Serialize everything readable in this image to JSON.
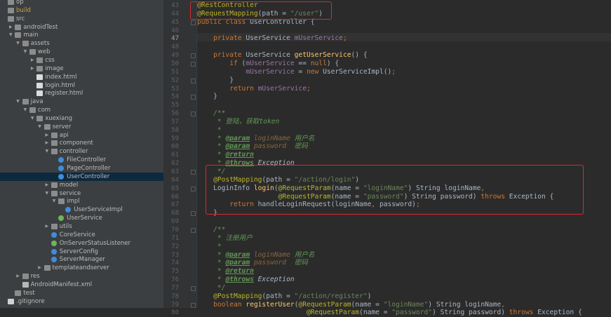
{
  "project_tree": [
    {
      "label": "op",
      "icon": "folder",
      "depth": 0,
      "arrow": ""
    },
    {
      "label": "build",
      "icon": "folder",
      "depth": 0,
      "arrow": "",
      "muted": true
    },
    {
      "label": "src",
      "icon": "folder",
      "depth": 0,
      "arrow": ""
    },
    {
      "label": "androidTest",
      "icon": "folder",
      "depth": 1,
      "arrow": "right"
    },
    {
      "label": "main",
      "icon": "folder",
      "depth": 1,
      "arrow": "down"
    },
    {
      "label": "assets",
      "icon": "folder",
      "depth": 2,
      "arrow": "down"
    },
    {
      "label": "web",
      "icon": "folder",
      "depth": 3,
      "arrow": "down"
    },
    {
      "label": "css",
      "icon": "folder",
      "depth": 4,
      "arrow": "right"
    },
    {
      "label": "image",
      "icon": "folder",
      "depth": 4,
      "arrow": "right"
    },
    {
      "label": "index.html",
      "icon": "html",
      "depth": 4,
      "arrow": ""
    },
    {
      "label": "login.html",
      "icon": "html",
      "depth": 4,
      "arrow": ""
    },
    {
      "label": "register.html",
      "icon": "html",
      "depth": 4,
      "arrow": ""
    },
    {
      "label": "java",
      "icon": "folder",
      "depth": 2,
      "arrow": "down"
    },
    {
      "label": "com",
      "icon": "pkg",
      "depth": 3,
      "arrow": "down"
    },
    {
      "label": "xuexiang",
      "icon": "pkg",
      "depth": 4,
      "arrow": "down"
    },
    {
      "label": "server",
      "icon": "pkg",
      "depth": 5,
      "arrow": "down"
    },
    {
      "label": "api",
      "icon": "pkg",
      "depth": 6,
      "arrow": "right"
    },
    {
      "label": "component",
      "icon": "pkg",
      "depth": 6,
      "arrow": "right"
    },
    {
      "label": "controller",
      "icon": "pkg",
      "depth": 6,
      "arrow": "down"
    },
    {
      "label": "FileController",
      "icon": "cls",
      "depth": 7,
      "arrow": ""
    },
    {
      "label": "PageController",
      "icon": "cls",
      "depth": 7,
      "arrow": ""
    },
    {
      "label": "UserController",
      "icon": "cls",
      "depth": 7,
      "arrow": "",
      "selected": true
    },
    {
      "label": "model",
      "icon": "pkg",
      "depth": 6,
      "arrow": "right"
    },
    {
      "label": "service",
      "icon": "pkg",
      "depth": 6,
      "arrow": "down"
    },
    {
      "label": "impl",
      "icon": "pkg",
      "depth": 7,
      "arrow": "down"
    },
    {
      "label": "UserServiceImpl",
      "icon": "cls",
      "depth": 8,
      "arrow": ""
    },
    {
      "label": "UserService",
      "icon": "iface",
      "depth": 7,
      "arrow": ""
    },
    {
      "label": "utils",
      "icon": "pkg",
      "depth": 6,
      "arrow": "right"
    },
    {
      "label": "CoreService",
      "icon": "cls",
      "depth": 6,
      "arrow": ""
    },
    {
      "label": "OnServerStatusListener",
      "icon": "iface",
      "depth": 6,
      "arrow": ""
    },
    {
      "label": "ServerConfig",
      "icon": "cls",
      "depth": 6,
      "arrow": ""
    },
    {
      "label": "ServerManager",
      "icon": "cls",
      "depth": 6,
      "arrow": ""
    },
    {
      "label": "templateandserver",
      "icon": "pkg",
      "depth": 5,
      "arrow": "right"
    },
    {
      "label": "res",
      "icon": "folder",
      "depth": 2,
      "arrow": "right"
    },
    {
      "label": "AndroidManifest.xml",
      "icon": "xml",
      "depth": 2,
      "arrow": ""
    },
    {
      "label": "test",
      "icon": "folder",
      "depth": 1,
      "arrow": ""
    },
    {
      "label": ".gitignore",
      "icon": "file",
      "depth": 0,
      "arrow": ""
    }
  ],
  "code_lines": [
    {
      "n": "43",
      "t": [
        [
          "an",
          "@RestController"
        ]
      ]
    },
    {
      "n": "44",
      "t": [
        [
          "an",
          "@RequestMapping"
        ],
        [
          "",
          "(path = "
        ],
        [
          "st",
          "\"/user\""
        ],
        [
          "",
          ")"
        ]
      ]
    },
    {
      "n": "45",
      "t": [
        [
          "kw",
          "public class "
        ],
        [
          "",
          "UserController {"
        ]
      ]
    },
    {
      "n": "46",
      "t": []
    },
    {
      "n": "47",
      "t": [
        [
          "",
          "    "
        ],
        [
          "kw",
          "private "
        ],
        [
          "",
          "UserService "
        ],
        [
          "fd",
          "mUserService"
        ],
        [
          "kw",
          ";"
        ]
      ]
    },
    {
      "n": "48",
      "t": []
    },
    {
      "n": "49",
      "t": [
        [
          "",
          "    "
        ],
        [
          "kw",
          "private "
        ],
        [
          "",
          "UserService "
        ],
        [
          "mt",
          "getUserService"
        ],
        [
          "",
          "() {"
        ]
      ]
    },
    {
      "n": "50",
      "t": [
        [
          "",
          "        "
        ],
        [
          "kw",
          "if "
        ],
        [
          "",
          "("
        ],
        [
          "fd",
          "mUserService"
        ],
        [
          "",
          " == "
        ],
        [
          "kw",
          "null"
        ],
        [
          "",
          ") {"
        ]
      ]
    },
    {
      "n": "51",
      "t": [
        [
          "",
          "            "
        ],
        [
          "fd",
          "mUserService"
        ],
        [
          "",
          " = "
        ],
        [
          "kw",
          "new "
        ],
        [
          "",
          "UserServiceImpl()"
        ],
        [
          "kw",
          ";"
        ]
      ]
    },
    {
      "n": "52",
      "t": [
        [
          "",
          "        }"
        ]
      ]
    },
    {
      "n": "53",
      "t": [
        [
          "",
          "        "
        ],
        [
          "kw",
          "return "
        ],
        [
          "fd",
          "mUserService"
        ],
        [
          "kw",
          ";"
        ]
      ]
    },
    {
      "n": "54",
      "t": [
        [
          "",
          "    }"
        ]
      ]
    },
    {
      "n": "55",
      "t": []
    },
    {
      "n": "56",
      "t": [
        [
          "cm",
          "    /**"
        ]
      ]
    },
    {
      "n": "57",
      "t": [
        [
          "cm",
          "     * 登陆，获取token"
        ]
      ]
    },
    {
      "n": "58",
      "t": [
        [
          "cm",
          "     *"
        ]
      ]
    },
    {
      "n": "59",
      "t": [
        [
          "cm",
          "     * "
        ],
        [
          "tg",
          "@param"
        ],
        [
          "cm",
          " "
        ],
        [
          "pv",
          "loginName"
        ],
        [
          "cm",
          " 用户名"
        ]
      ]
    },
    {
      "n": "60",
      "t": [
        [
          "cm",
          "     * "
        ],
        [
          "tg",
          "@param"
        ],
        [
          "cm",
          " "
        ],
        [
          "pv",
          "password"
        ],
        [
          "cm",
          "  密码"
        ]
      ]
    },
    {
      "n": "61",
      "t": [
        [
          "cm",
          "     * "
        ],
        [
          "tg",
          "@return"
        ]
      ]
    },
    {
      "n": "62",
      "t": [
        [
          "cm",
          "     * "
        ],
        [
          "tg",
          "@throws"
        ],
        [
          "cm",
          " "
        ],
        [
          "ex",
          "Exception"
        ]
      ]
    },
    {
      "n": "63",
      "t": [
        [
          "cm",
          "     */"
        ]
      ]
    },
    {
      "n": "64",
      "t": [
        [
          "",
          "    "
        ],
        [
          "an",
          "@PostMapping"
        ],
        [
          "",
          "(path = "
        ],
        [
          "st",
          "\"/action/login\""
        ],
        [
          "",
          ")"
        ]
      ]
    },
    {
      "n": "65",
      "t": [
        [
          "",
          "    LoginInfo "
        ],
        [
          "mt",
          "login"
        ],
        [
          "",
          "("
        ],
        [
          "an",
          "@RequestParam"
        ],
        [
          "",
          "(name = "
        ],
        [
          "st",
          "\"loginName\""
        ],
        [
          "",
          ") String loginName"
        ],
        [
          "kw",
          ","
        ]
      ]
    },
    {
      "n": "66",
      "t": [
        [
          "",
          "                    "
        ],
        [
          "an",
          "@RequestParam"
        ],
        [
          "",
          "(name = "
        ],
        [
          "st",
          "\"password\""
        ],
        [
          "",
          ") String password) "
        ],
        [
          "kw",
          "throws "
        ],
        [
          "",
          "Exception {"
        ]
      ]
    },
    {
      "n": "67",
      "t": [
        [
          "",
          "        "
        ],
        [
          "kw",
          "return "
        ],
        [
          "",
          "handleLoginRequest(loginName"
        ],
        [
          "kw",
          ", "
        ],
        [
          "",
          "password)"
        ],
        [
          "kw",
          ";"
        ]
      ]
    },
    {
      "n": "68",
      "t": [
        [
          "",
          "    }"
        ]
      ]
    },
    {
      "n": "69",
      "t": []
    },
    {
      "n": "70",
      "t": [
        [
          "cm",
          "    /**"
        ]
      ]
    },
    {
      "n": "71",
      "t": [
        [
          "cm",
          "     * 注册用户"
        ]
      ]
    },
    {
      "n": "72",
      "t": [
        [
          "cm",
          "     *"
        ]
      ]
    },
    {
      "n": "73",
      "t": [
        [
          "cm",
          "     * "
        ],
        [
          "tg",
          "@param"
        ],
        [
          "cm",
          " "
        ],
        [
          "pv",
          "loginName"
        ],
        [
          "cm",
          " 用户名"
        ]
      ]
    },
    {
      "n": "74",
      "t": [
        [
          "cm",
          "     * "
        ],
        [
          "tg",
          "@param"
        ],
        [
          "cm",
          " "
        ],
        [
          "pv",
          "password"
        ],
        [
          "cm",
          "  密码"
        ]
      ]
    },
    {
      "n": "75",
      "t": [
        [
          "cm",
          "     * "
        ],
        [
          "tg",
          "@return"
        ]
      ]
    },
    {
      "n": "76",
      "t": [
        [
          "cm",
          "     * "
        ],
        [
          "tg",
          "@throws"
        ],
        [
          "cm",
          " "
        ],
        [
          "ex",
          "Exception"
        ]
      ]
    },
    {
      "n": "77",
      "t": [
        [
          "cm",
          "     */"
        ]
      ]
    },
    {
      "n": "78",
      "t": [
        [
          "",
          "    "
        ],
        [
          "an",
          "@PostMapping"
        ],
        [
          "",
          "(path = "
        ],
        [
          "st",
          "\"/action/register\""
        ],
        [
          "",
          ")"
        ]
      ]
    },
    {
      "n": "79",
      "t": [
        [
          "",
          "    "
        ],
        [
          "kw",
          "boolean "
        ],
        [
          "mt",
          "registerUser"
        ],
        [
          "",
          "("
        ],
        [
          "an",
          "@RequestParam"
        ],
        [
          "",
          "(name = "
        ],
        [
          "st",
          "\"loginName\""
        ],
        [
          "",
          ") String loginName"
        ],
        [
          "kw",
          ","
        ]
      ]
    },
    {
      "n": "80",
      "t": [
        [
          "",
          "                           "
        ],
        [
          "an",
          "@RequestParam"
        ],
        [
          "",
          "(name = "
        ],
        [
          "st",
          "\"password\""
        ],
        [
          "",
          ") String password) "
        ],
        [
          "kw",
          "throws "
        ],
        [
          "",
          "Exception {"
        ]
      ]
    }
  ],
  "current_line": "47",
  "highlight_color": "#d42c2c"
}
